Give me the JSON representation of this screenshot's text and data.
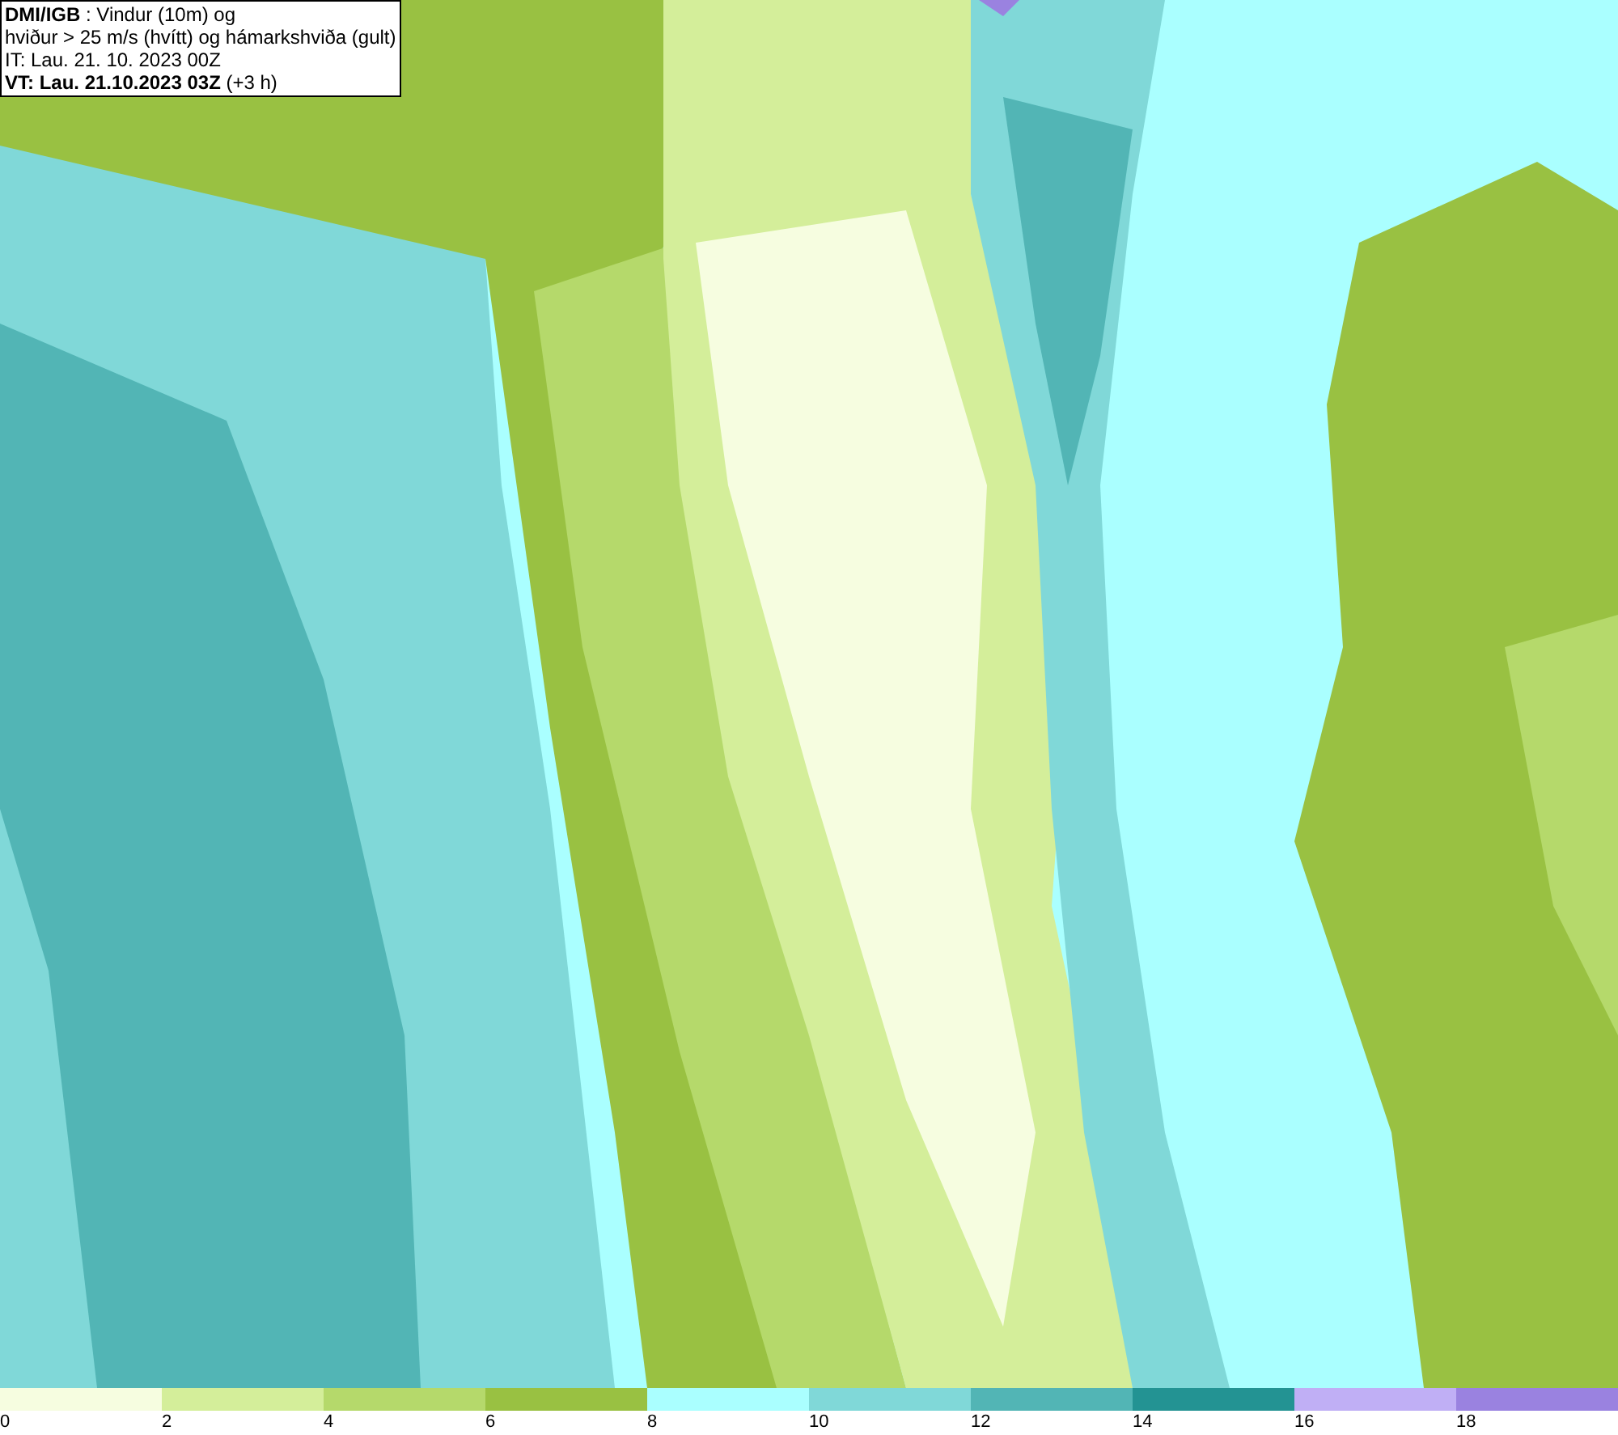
{
  "header": {
    "lines": [
      "**DMI/IGB** : Vindur (10m) og",
      "hviður > 25 m/s (hvítt) og hámarkshviða (gult)",
      "IT: Lau. 21. 10. 2023 00Z",
      "**VT: Lau. 21.10.2023 03Z** (+3 h)"
    ]
  },
  "legend": {
    "bins": [
      {
        "color": "#f6fde0",
        "label": "0"
      },
      {
        "color": "#d4ee9a",
        "label": "2"
      },
      {
        "color": "#b5d96b",
        "label": "4"
      },
      {
        "color": "#99c142",
        "label": "6"
      },
      {
        "color": "#aaffff",
        "label": "8"
      },
      {
        "color": "#80d8d8",
        "label": "10"
      },
      {
        "color": "#52b5b5",
        "label": "12"
      },
      {
        "color": "#239393",
        "label": "14"
      },
      {
        "color": "#c0aff5",
        "label": "16"
      },
      {
        "color": "#9a82e0",
        "label": "18"
      }
    ]
  }
}
